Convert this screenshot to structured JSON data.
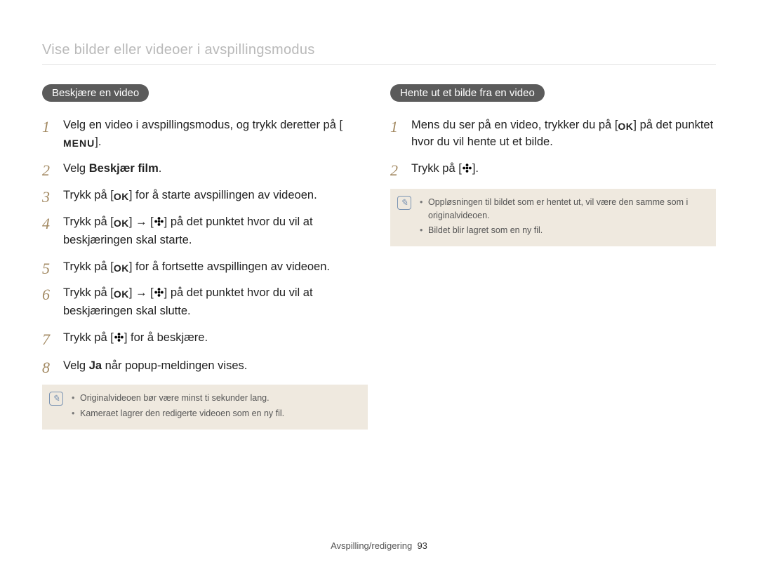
{
  "breadcrumb": "Vise bilder eller videoer i avspillingsmodus",
  "left": {
    "heading": "Beskjære en video",
    "steps": [
      {
        "pre": "Velg en video i avspillingsmodus, og trykk deretter på [",
        "icon": "MENU",
        "post": "]."
      },
      {
        "pre": "Velg ",
        "bold": "Beskjær film",
        "post": "."
      },
      {
        "pre": "Trykk på [",
        "icon": "OK",
        "post": "] for å starte avspillingen av videoen."
      },
      {
        "pre": "Trykk på [",
        "icon": "OK",
        "mid": "] → [",
        "icon2": "flower",
        "post": "] på det punktet hvor du vil at beskjæringen skal starte."
      },
      {
        "pre": "Trykk på [",
        "icon": "OK",
        "post": "] for å fortsette avspillingen av videoen."
      },
      {
        "pre": "Trykk på [",
        "icon": "OK",
        "mid": "] → [",
        "icon2": "flower",
        "post": "] på det punktet hvor du vil at beskjæringen skal slutte."
      },
      {
        "pre": "Trykk på [",
        "icon": "flower",
        "post": "] for å beskjære."
      },
      {
        "pre": "Velg ",
        "bold": "Ja",
        "post": " når popup-meldingen vises."
      }
    ],
    "notes": [
      "Originalvideoen bør være minst ti sekunder lang.",
      "Kameraet lagrer den redigerte videoen som en ny fil."
    ]
  },
  "right": {
    "heading": "Hente ut et bilde fra en video",
    "steps": [
      {
        "pre": "Mens du ser på en video, trykker du på [",
        "icon": "OK",
        "post": "] på det punktet hvor du vil hente ut et bilde."
      },
      {
        "pre": "Trykk på [",
        "icon": "flower",
        "post": "]."
      }
    ],
    "notes": [
      "Oppløsningen til bildet som er hentet ut, vil være den samme som i originalvideoen.",
      "Bildet blir lagret som en ny fil."
    ]
  },
  "footer": {
    "section": "Avspilling/redigering",
    "page": "93"
  },
  "icons": {
    "MENU": "MENU",
    "OK": "OK"
  }
}
